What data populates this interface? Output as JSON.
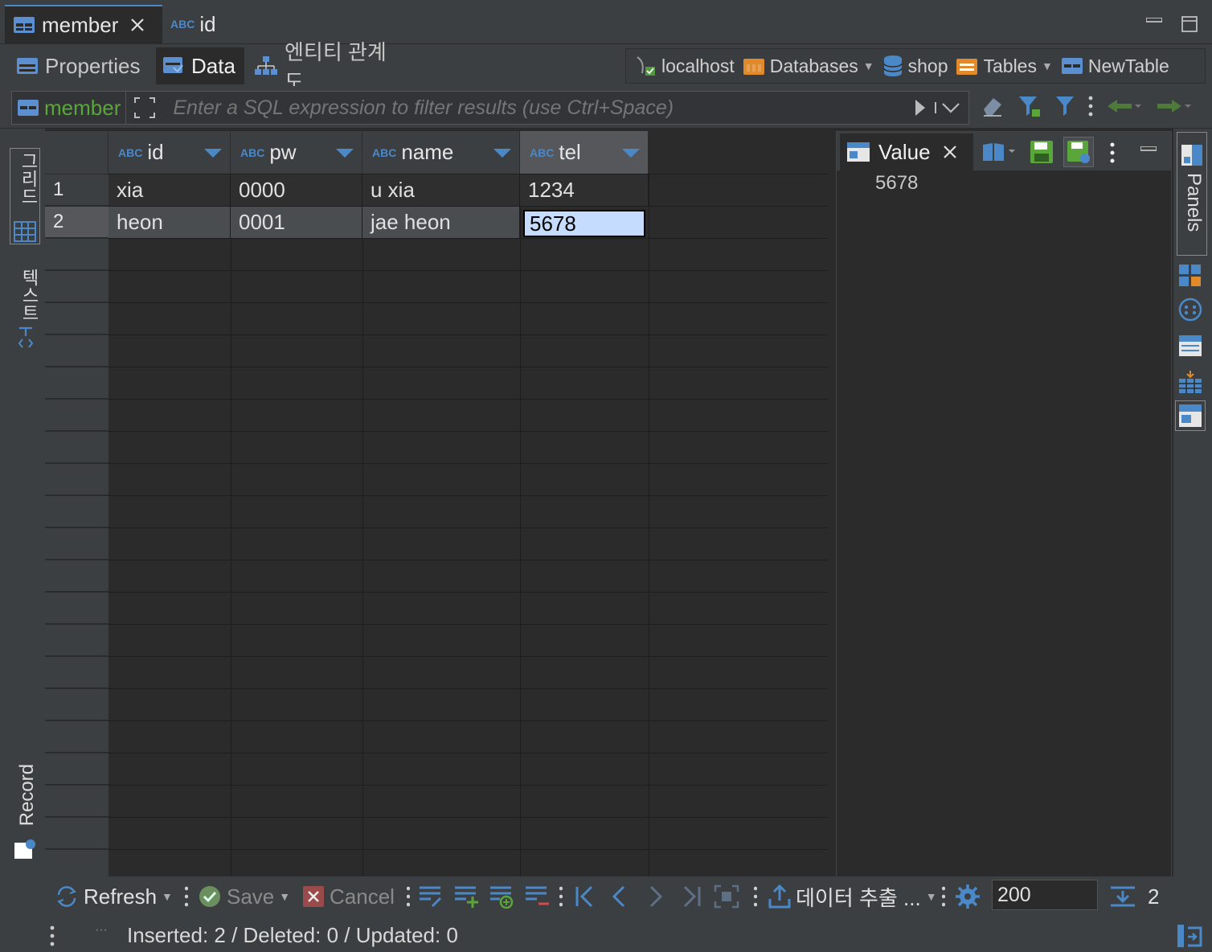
{
  "editor_tabs": [
    {
      "label": "member",
      "icon": "table-icon"
    },
    {
      "label": "id",
      "icon": "abc-icon"
    }
  ],
  "sub_tabs": [
    {
      "label": "Properties"
    },
    {
      "label": "Data"
    },
    {
      "label": "엔티티 관계도"
    }
  ],
  "breadcrumb": {
    "connection": "localhost",
    "databases": "Databases",
    "schema": "shop",
    "tables": "Tables",
    "table": "NewTable"
  },
  "filter": {
    "entity": "member",
    "placeholder": "Enter a SQL expression to filter results (use Ctrl+Space)"
  },
  "left_views": {
    "grid": "그리드",
    "text": "텍스트",
    "record": "Record"
  },
  "abc_tag": "ABC",
  "grid": {
    "columns": [
      "id",
      "pw",
      "name",
      "tel"
    ],
    "rows": [
      {
        "num": "1",
        "cells": [
          "xia",
          "0000",
          "u xia",
          "1234"
        ]
      },
      {
        "num": "2",
        "cells": [
          "heon",
          "0001",
          "jae heon",
          "5678"
        ]
      }
    ],
    "selected": {
      "row": 2,
      "col": "tel"
    }
  },
  "value_panel": {
    "title": "Value",
    "content": "5678"
  },
  "right_panels": {
    "label": "Panels"
  },
  "bottom_toolbar": {
    "refresh": "Refresh",
    "save": "Save",
    "cancel": "Cancel",
    "export": "데이터 추출 ...",
    "page_size": "200",
    "row_count": "2"
  },
  "status": {
    "text": "Inserted: 2 / Deleted: 0 / Updated: 0"
  },
  "colors": {
    "accent": "#4a88c7",
    "entity_green": "#5aa63b",
    "selection": "#c5dcff"
  }
}
